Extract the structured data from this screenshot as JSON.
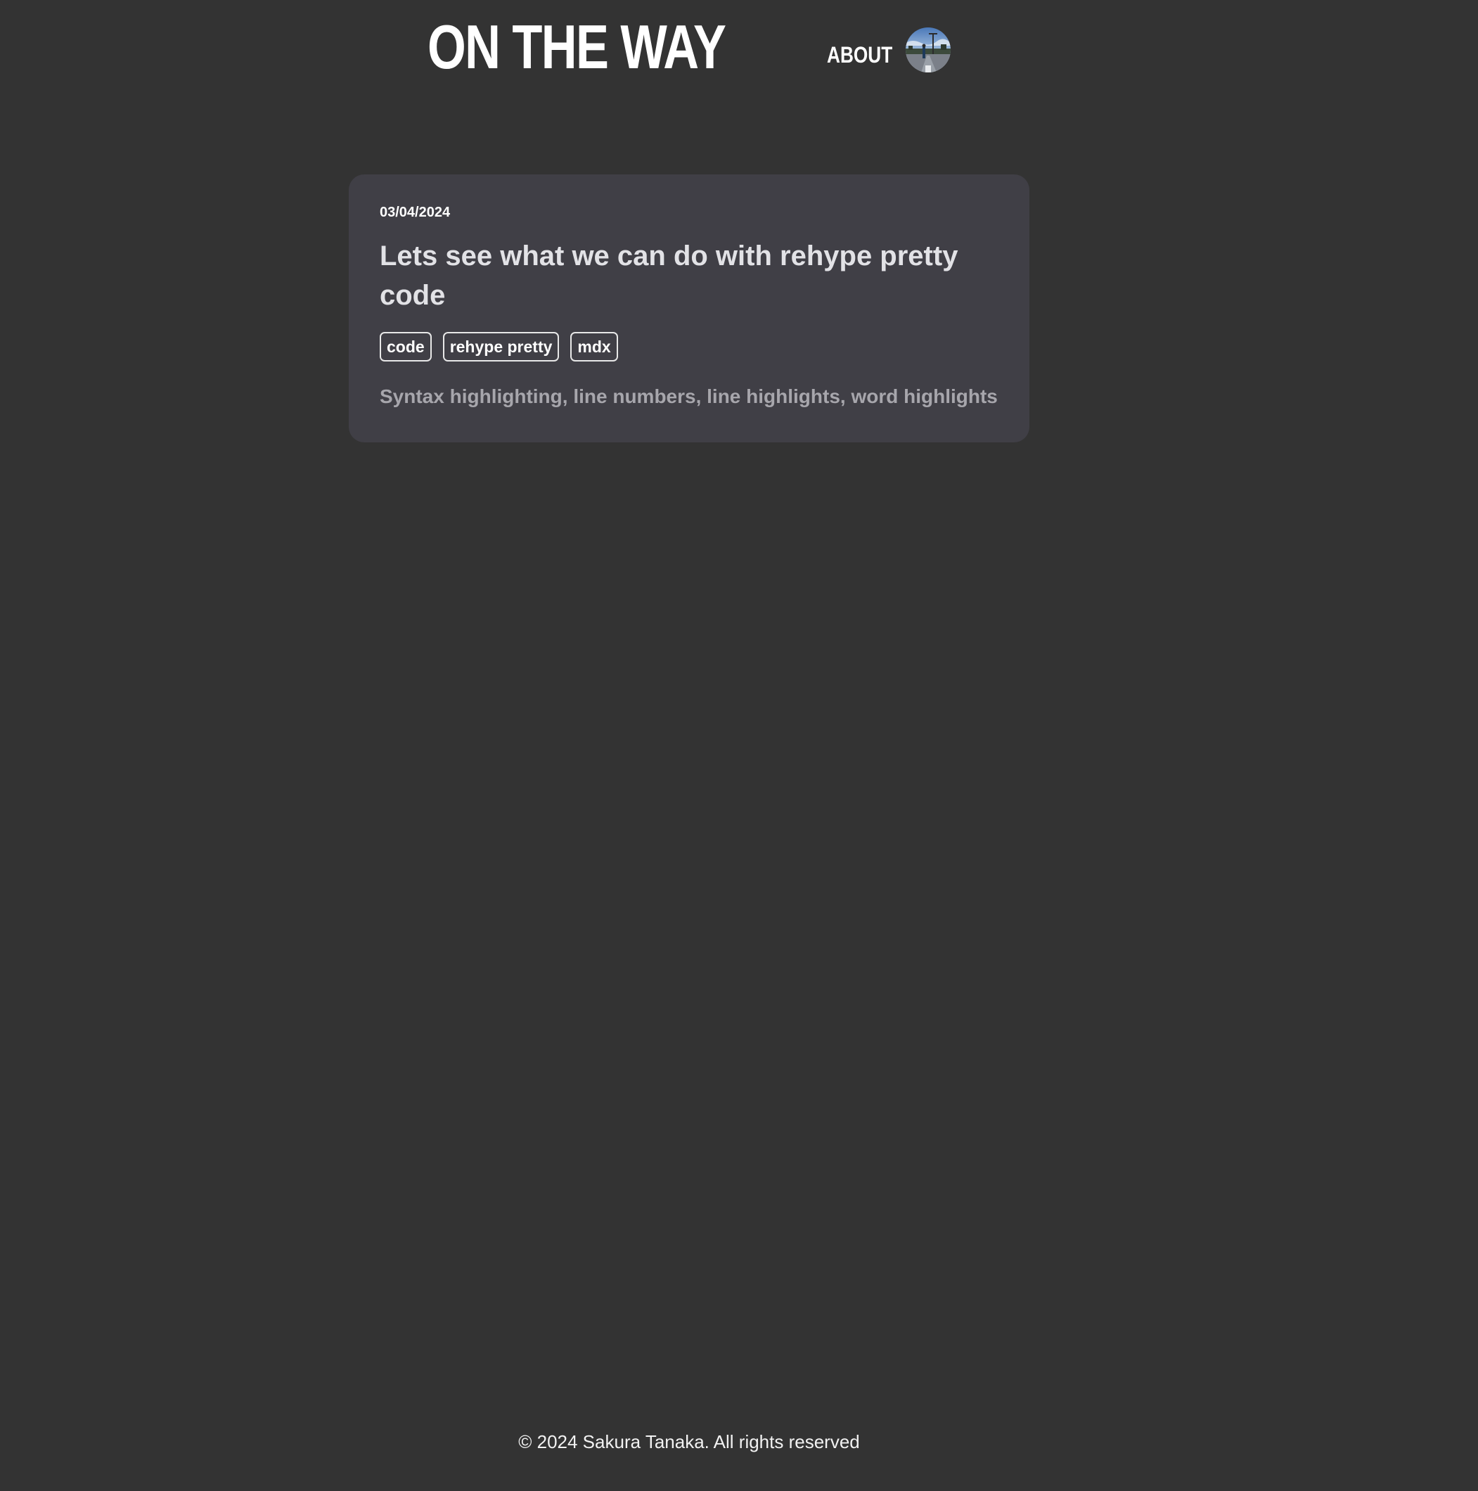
{
  "header": {
    "site_title": "ON THE WAY",
    "nav": {
      "about_label": "ABOUT"
    }
  },
  "posts": [
    {
      "date": "03/04/2024",
      "title": "Lets see what we can do with rehype pretty code",
      "tags": [
        "code",
        "rehype pretty",
        "mdx"
      ],
      "description": "Syntax highlighting, line numbers, line highlights, word highlights"
    }
  ],
  "footer": {
    "copyright": "© 2024 Sakura Tanaka. All rights reserved"
  },
  "colors": {
    "background": "#333333",
    "card": "#403f46",
    "title_text": "#e2e2e6",
    "description_text": "#a7a6ac"
  }
}
